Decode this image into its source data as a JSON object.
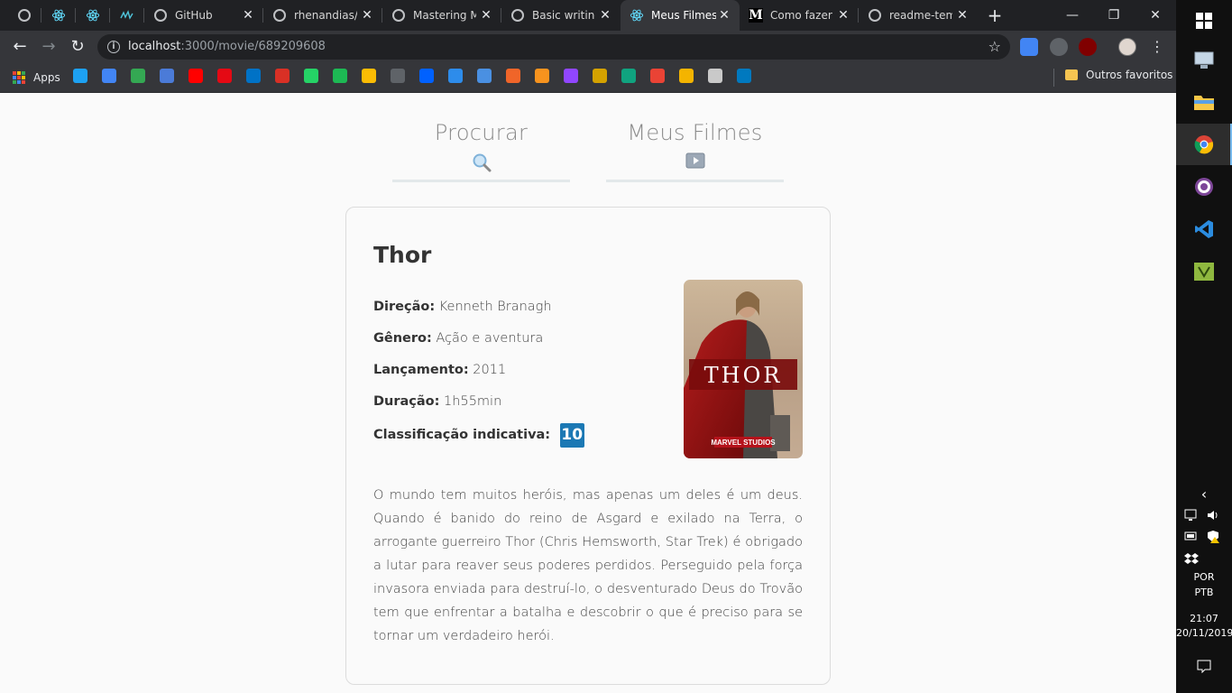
{
  "browser": {
    "tabs": [
      {
        "title": "",
        "icon": "github-icon",
        "pinned": true
      },
      {
        "title": "",
        "icon": "react-icon",
        "pinned": true
      },
      {
        "title": "",
        "icon": "react-icon",
        "pinned": true
      },
      {
        "title": "",
        "icon": "dyte-icon",
        "pinned": true
      },
      {
        "title": "GitHub",
        "icon": "github-icon",
        "pinned": false
      },
      {
        "title": "rhenandias/M",
        "icon": "github-icon",
        "pinned": false
      },
      {
        "title": "Mastering M",
        "icon": "github-icon",
        "pinned": false
      },
      {
        "title": "Basic writing",
        "icon": "github-icon",
        "pinned": false
      },
      {
        "title": "Meus Filmes",
        "icon": "react-icon",
        "pinned": false,
        "active": true
      },
      {
        "title": "Como fazer",
        "icon": "medium-icon",
        "pinned": false
      },
      {
        "title": "readme-tem",
        "icon": "github-icon",
        "pinned": false
      }
    ],
    "tab_close_glyph": "✕",
    "new_tab_glyph": "+",
    "window_controls": {
      "minimize": "—",
      "restore": "❐",
      "close": "✕"
    },
    "nav": {
      "back": "←",
      "forward": "→",
      "reload": "↻"
    },
    "address": {
      "info": "i",
      "host": "localhost",
      "path": ":3000/movie/689209608"
    },
    "star": "☆",
    "menu_dots": "⋮",
    "bookmarks": {
      "apps_label": "Apps",
      "others_label": "Outros favoritos",
      "icons": [
        {
          "name": "twitter-icon",
          "color": "#1da1f2"
        },
        {
          "name": "google-translate-icon",
          "color": "#4285f4"
        },
        {
          "name": "google-maps-icon",
          "color": "#34a853"
        },
        {
          "name": "globe-icon",
          "color": "#4b7bd8"
        },
        {
          "name": "youtube-icon",
          "color": "#ff0000"
        },
        {
          "name": "netflix-icon",
          "color": "#e50914"
        },
        {
          "name": "outlook-icon",
          "color": "#0072c6"
        },
        {
          "name": "gmail-icon",
          "color": "#d93025"
        },
        {
          "name": "whatsapp-icon",
          "color": "#25d366"
        },
        {
          "name": "spotify-icon",
          "color": "#1db954"
        },
        {
          "name": "keep-icon",
          "color": "#fbbc04"
        },
        {
          "name": "suap-icon",
          "color": "#5f6368"
        },
        {
          "name": "dropbox-icon",
          "color": "#0061ff"
        },
        {
          "name": "trello-t-icon",
          "color": "#2d8ceb"
        },
        {
          "name": "editor-icon",
          "color": "#4a90e2"
        },
        {
          "name": "hexagon-icon",
          "color": "#f06529"
        },
        {
          "name": "gear-orange-icon",
          "color": "#f7931e"
        },
        {
          "name": "twitch-icon",
          "color": "#9146ff"
        },
        {
          "name": "rw-icon",
          "color": "#d4a200"
        },
        {
          "name": "person-icon",
          "color": "#10a37f"
        },
        {
          "name": "calendar-59-icon",
          "color": "#ea4335"
        },
        {
          "name": "trophy-icon",
          "color": "#f4b400"
        },
        {
          "name": "github-bookmark-icon",
          "color": "#c9c9c9"
        },
        {
          "name": "trello-icon",
          "color": "#0079bf"
        }
      ]
    }
  },
  "nav": {
    "search": {
      "label": "Procurar",
      "icon": "🔍"
    },
    "my_movies": {
      "label": "Meus Filmes",
      "icon": "▶"
    }
  },
  "movie": {
    "title": "Thor",
    "direction_label": "Direção:",
    "direction": "Kenneth Branagh",
    "genre_label": "Gênero:",
    "genre": "Ação e aventura",
    "release_label": "Lançamento:",
    "release": "2011",
    "duration_label": "Duração:",
    "duration": "1h55min",
    "rating_label": "Classificação indicativa:",
    "rating": "10",
    "poster_title": "THOR",
    "poster_studio": "MARVEL STUDIOS",
    "synopsis": "O mundo tem muitos heróis, mas apenas um deles é um deus. Quando é banido do reino de Asgard e exilado na Terra, o arrogante guerreiro Thor (Chris Hemsworth, Star Trek) é obrigado a lutar para reaver seus poderes perdidos. Perseguido pela força invasora enviada para destruí-lo, o desventurado Deus do Trovão tem que enfrentar a batalha e descobrir o que é preciso para se tornar um verdadeiro herói."
  },
  "taskbar": {
    "language": "POR",
    "layout": "PTB",
    "time": "21:07",
    "date": "20/11/2019",
    "chevron": "‹"
  },
  "colors": {
    "accent_rating": "#1b78b4",
    "nav_underline": "#e3e8ea",
    "chrome_dark": "#202124",
    "chrome_toolbar": "#35363a"
  }
}
